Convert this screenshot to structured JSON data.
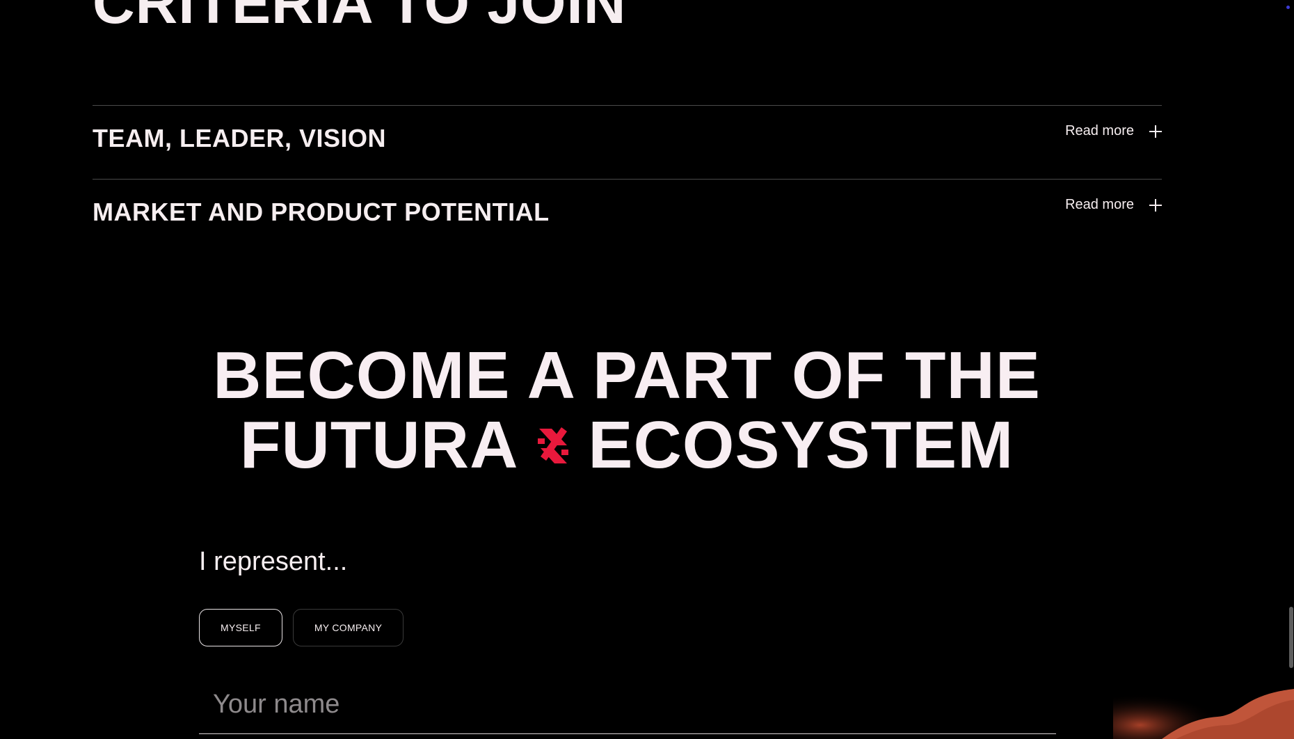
{
  "section": {
    "top_heading": "CRITERIA TO JOIN"
  },
  "accordion": {
    "items": [
      {
        "title": "TEAM, LEADER, VISION",
        "toggle_label": "Read more",
        "icon": "plus-icon"
      },
      {
        "title": "MARKET AND PRODUCT POTENTIAL",
        "toggle_label": "Read more",
        "icon": "plus-icon"
      }
    ]
  },
  "cta": {
    "line1": "BECOME A PART OF THE",
    "line2_left": "FUTURA",
    "line2_right": "ECOSYSTEM",
    "brand_icon": "futura-logo-icon",
    "brand_color": "#e8193c"
  },
  "form": {
    "represent_label": "I represent...",
    "choices": [
      {
        "label": "MYSELF",
        "selected": true
      },
      {
        "label": "MY COMPANY",
        "selected": false
      }
    ],
    "name_placeholder": "Your name"
  }
}
